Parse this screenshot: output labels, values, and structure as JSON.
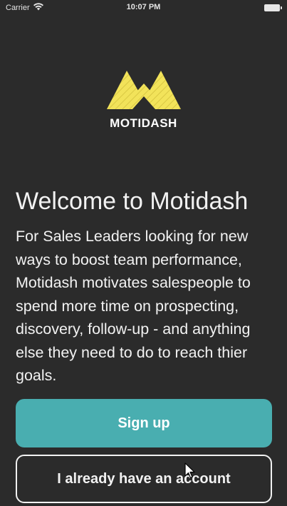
{
  "status_bar": {
    "carrier": "Carrier",
    "time": "10:07 PM",
    "wifi_icon": "wifi-icon",
    "battery_icon": "battery-icon"
  },
  "brand": {
    "name": "MOTIDASH",
    "logo_icon": "motidash-logo-icon",
    "logo_color": "#f2e35a"
  },
  "welcome": {
    "title": "Welcome to Motidash",
    "description": "For Sales Leaders looking for new ways to boost team performance, Motidash motivates salespeople to spend more time on prospecting, discovery, follow-up - and anything else they need to do to reach thier goals."
  },
  "actions": {
    "signup_label": "Sign up",
    "login_label": "I already have an account"
  },
  "colors": {
    "background": "#2b2b2b",
    "accent": "#49aeb0",
    "text": "#f2f2f2"
  }
}
